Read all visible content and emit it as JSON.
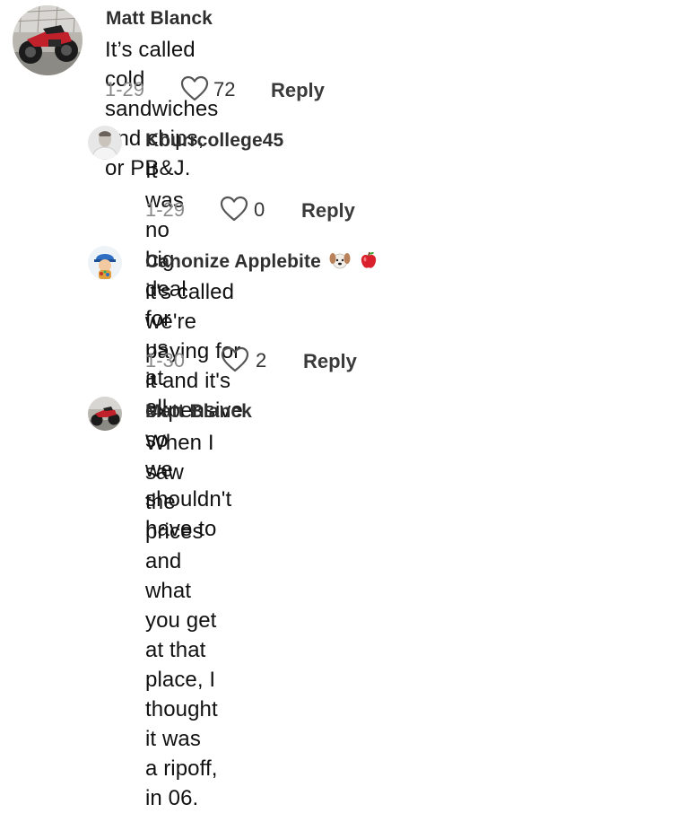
{
  "comments": [
    {
      "username": "Matt Blanck",
      "text": "It’s called cold sandwiches and chips, or PB&J.",
      "date": "1-29",
      "likes": "72",
      "reply_label": "Reply",
      "avatar_icon": "motorcycle-avatar"
    },
    {
      "username": "Kburrcollege45",
      "text": "It was no big deal for us at all.",
      "date": "1-29",
      "likes": "0",
      "reply_label": "Reply",
      "avatar_icon": "person-avatar"
    },
    {
      "username": "Canonize Applebite",
      "username_emojis": [
        "dog-face-emoji",
        "red-apple-emoji"
      ],
      "text": "it's called we're paying for it and it's expensive so\nwe shouldn't have to",
      "date": "1-30",
      "likes": "2",
      "reply_label": "Reply",
      "avatar_icon": "cartoon-avatar"
    },
    {
      "username": "Matt Blanck",
      "text": "When I saw the prices and what you get at that\nplace, I thought it was a ripoff, in 06.",
      "avatar_icon": "motorcycle-avatar"
    }
  ],
  "colors": {
    "username": "#2f2f2f",
    "meta_gray": "#8a8a8a",
    "heart_stroke": "#555555"
  }
}
